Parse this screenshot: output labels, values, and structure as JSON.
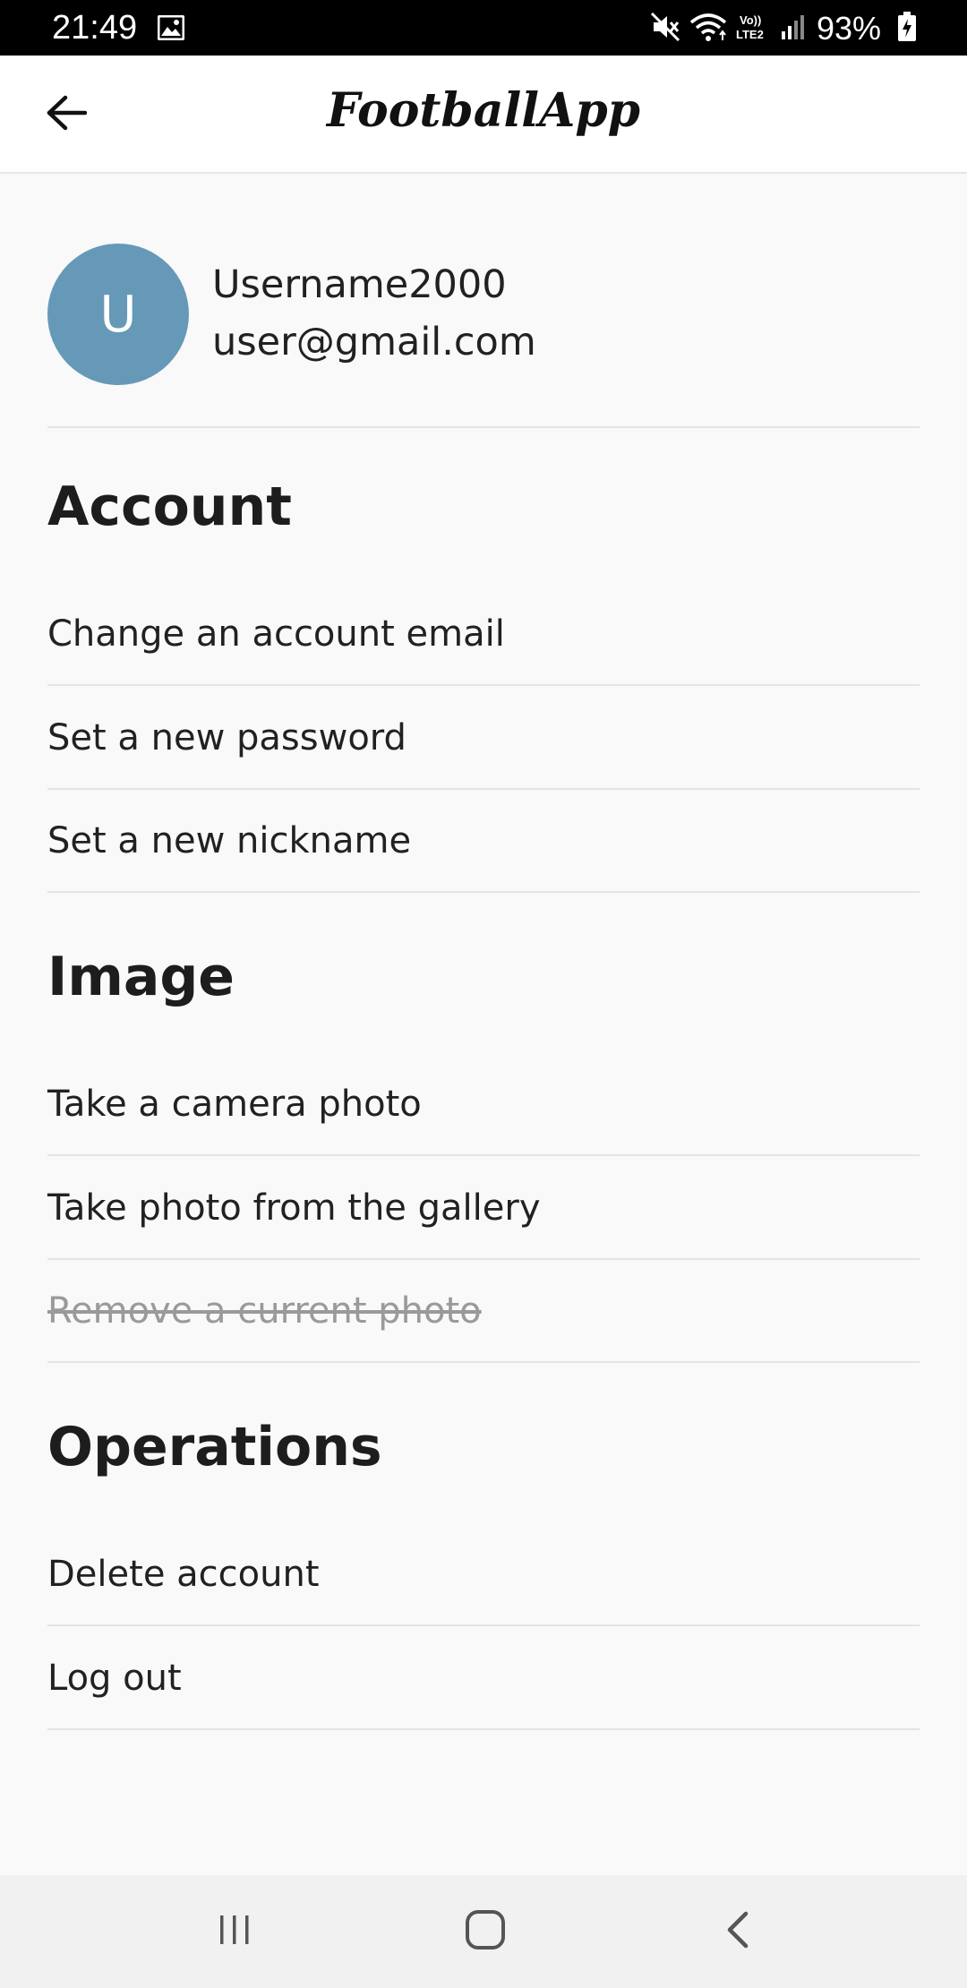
{
  "status_bar": {
    "time": "21:49",
    "battery": "93%",
    "icons": [
      "gallery-icon",
      "mute-icon",
      "wifi-icon",
      "volte-icon",
      "signal-icon",
      "battery-icon"
    ]
  },
  "app_bar": {
    "title": "FootballApp",
    "back_icon": "arrow-left-icon"
  },
  "profile": {
    "avatar_letter": "U",
    "avatar_color": "#6699b8",
    "username": "Username2000",
    "email": "user@gmail.com"
  },
  "sections": {
    "account": {
      "title": "Account",
      "items": [
        "Change an account email",
        "Set a new password",
        "Set a new nickname"
      ]
    },
    "image": {
      "title": "Image",
      "items": [
        "Take a camera photo",
        "Take photo from the gallery",
        "Remove a current photo"
      ]
    },
    "operations": {
      "title": "Operations",
      "items": [
        "Delete account",
        "Log out"
      ]
    }
  },
  "nav_bar": {
    "icons": [
      "recent-apps-icon",
      "home-icon",
      "back-icon"
    ]
  }
}
